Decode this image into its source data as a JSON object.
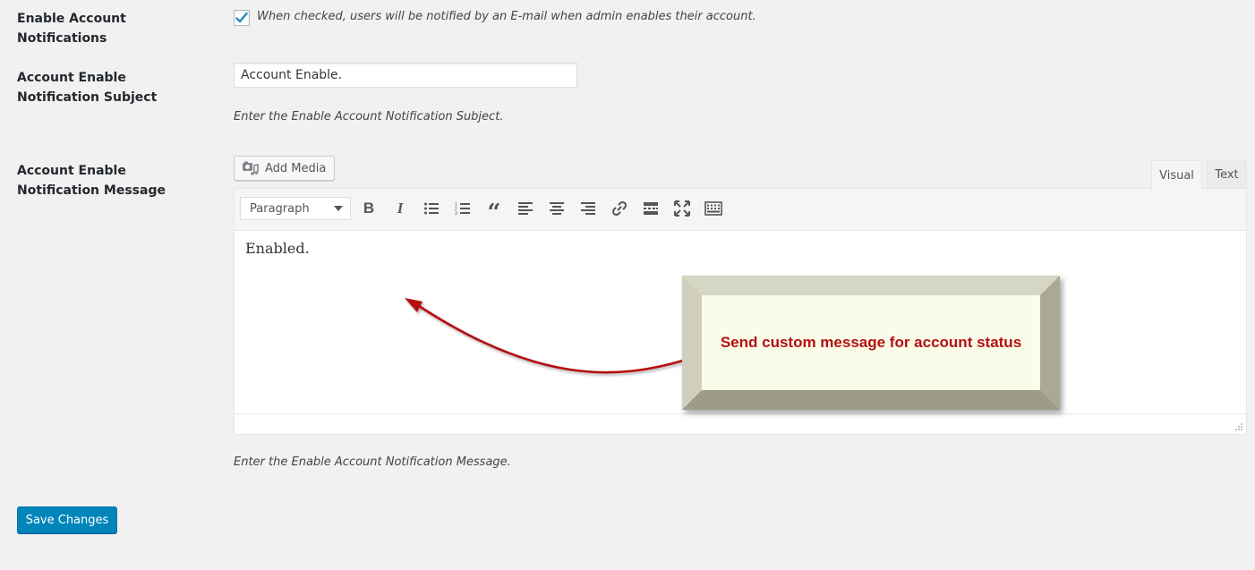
{
  "settings": {
    "enable_notifications": {
      "label": "Enable Account Notifications",
      "checked": true,
      "description": "When checked, users will be notified by an E-mail when admin enables their account."
    },
    "subject": {
      "label": "Account Enable Notification Subject",
      "value": "Account Enable.",
      "description": "Enter the Enable Account Notification Subject."
    },
    "message": {
      "label": "Account Enable Notification Message",
      "description": "Enter the Enable Account Notification Message."
    }
  },
  "editor": {
    "add_media_label": "Add Media",
    "tabs": {
      "visual": "Visual",
      "text": "Text"
    },
    "format_select": "Paragraph",
    "toolbar_icons": [
      "bold-icon",
      "italic-icon",
      "bulleted-list-icon",
      "numbered-list-icon",
      "blockquote-icon",
      "align-left-icon",
      "align-center-icon",
      "align-right-icon",
      "link-icon",
      "read-more-icon",
      "fullscreen-icon",
      "toolbar-toggle-icon"
    ],
    "content": "Enabled."
  },
  "callout": {
    "text": "Send custom message for account status",
    "text_color": "#b31212"
  },
  "actions": {
    "save_label": "Save Changes",
    "save_color": "#0085ba"
  }
}
